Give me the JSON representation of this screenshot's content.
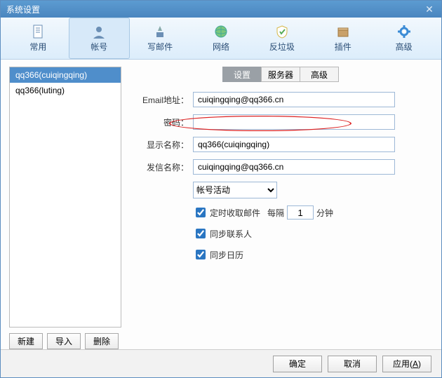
{
  "title": "系统设置",
  "toolbar": [
    "常用",
    "帐号",
    "写邮件",
    "网络",
    "反垃圾",
    "插件",
    "高级"
  ],
  "toolbar_active": 1,
  "accounts": [
    "qq366(cuiqingqing)",
    "qq366(luting)"
  ],
  "account_selected": 0,
  "sidebtns": {
    "new": "新建",
    "import": "导入",
    "delete": "删除"
  },
  "tabs": [
    "设置",
    "服务器",
    "高级"
  ],
  "tab_active": 0,
  "form": {
    "email_label": "Email地址：",
    "email_value": "cuiqingqing@qq366.cn",
    "password_label": "密码：",
    "password_value": "",
    "display_label": "显示名称：",
    "display_value": "qq366(cuiqingqing)",
    "sender_label": "发信名称：",
    "sender_value": "cuiqingqing@qq366.cn",
    "status_value": "帐号活动",
    "check_interval_label": "定时收取邮件",
    "interval_prefix": "每隔",
    "interval_value": "1",
    "interval_suffix": "分钟",
    "sync_contacts": "同步联系人",
    "sync_calendar": "同步日历"
  },
  "footer": {
    "ok": "确定",
    "cancel": "取消",
    "apply": "应用(",
    "apply_u": "A",
    "apply_end": ")"
  }
}
